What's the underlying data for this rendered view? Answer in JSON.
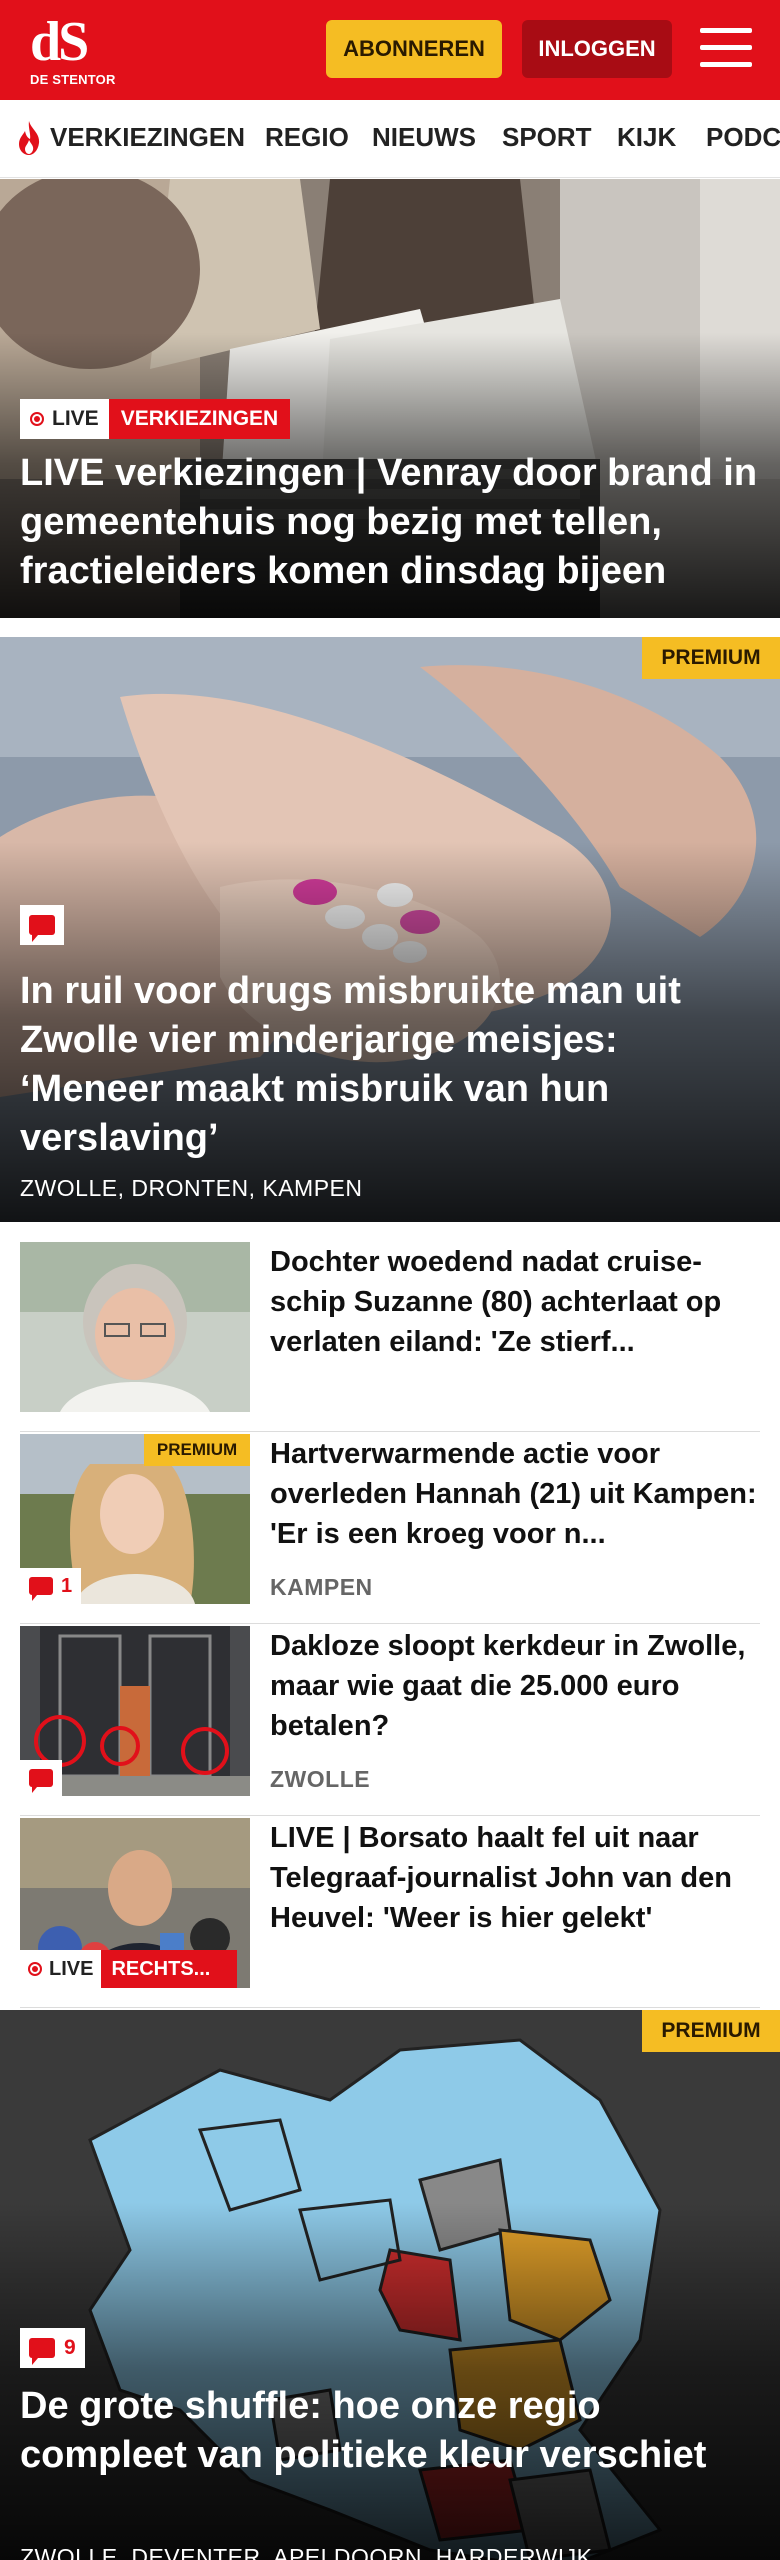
{
  "header": {
    "logo_mark": "dS",
    "logo_sub": "DE STENTOR",
    "subscribe_label": "ABONNEREN",
    "login_label": "INLOGGEN",
    "brand_color": "#e1101a",
    "accent_color": "#f5bd23",
    "menu_icon": "hamburger-menu-icon"
  },
  "nav": {
    "items": [
      {
        "label": "VERKIEZINGEN",
        "icon": "flame-icon"
      },
      {
        "label": "REGIO"
      },
      {
        "label": "NIEUWS"
      },
      {
        "label": "SPORT"
      },
      {
        "label": "KIJK"
      },
      {
        "label": "PODC"
      }
    ]
  },
  "hero1": {
    "live_label": "LIVE",
    "category": "VERKIEZINGEN",
    "title": "LIVE verkiezingen | Venray door brand in gemeentehuis nog bezig met tellen, fractieleiders komen dinsdag bijeen"
  },
  "hero2": {
    "premium_label": "PREMIUM",
    "icon": "comment-icon",
    "title": "In ruil voor drugs misbruikte man uit Zwolle vier minderjarige meisjes: ‘Meneer maakt misbruik van hun verslaving’",
    "location": "ZWOLLE, DRONTEN, KAMPEN"
  },
  "list": [
    {
      "title": "Dochter woedend nadat cruise-schip Suzanne (80) achterlaat op verlaten eiland: 'Ze stierf...",
      "location": ""
    },
    {
      "title": "Hartverwarmende actie voor overleden Hannah (21) uit Kampen: 'Er is een kroeg voor n...",
      "location": "KAMPEN",
      "premium_label": "PREMIUM",
      "comments": "1"
    },
    {
      "title": "Dakloze sloopt kerkdeur in Zwolle, maar wie gaat die 25.000 euro betalen?",
      "location": "ZWOLLE"
    },
    {
      "title": "LIVE | Borsato haalt fel uit naar Telegraaf-journalist John van den Heuvel: 'Weer is hier gelekt'",
      "location": "",
      "live_label": "LIVE",
      "category": "RECHTS..."
    }
  ],
  "hero3": {
    "premium_label": "PREMIUM",
    "comments": "9",
    "title": "De grote shuffle: hoe onze regio compleet van politieke kleur verschiet",
    "location": "ZWOLLE, DEVENTER, APELDOORN, HARDERWIJK"
  }
}
